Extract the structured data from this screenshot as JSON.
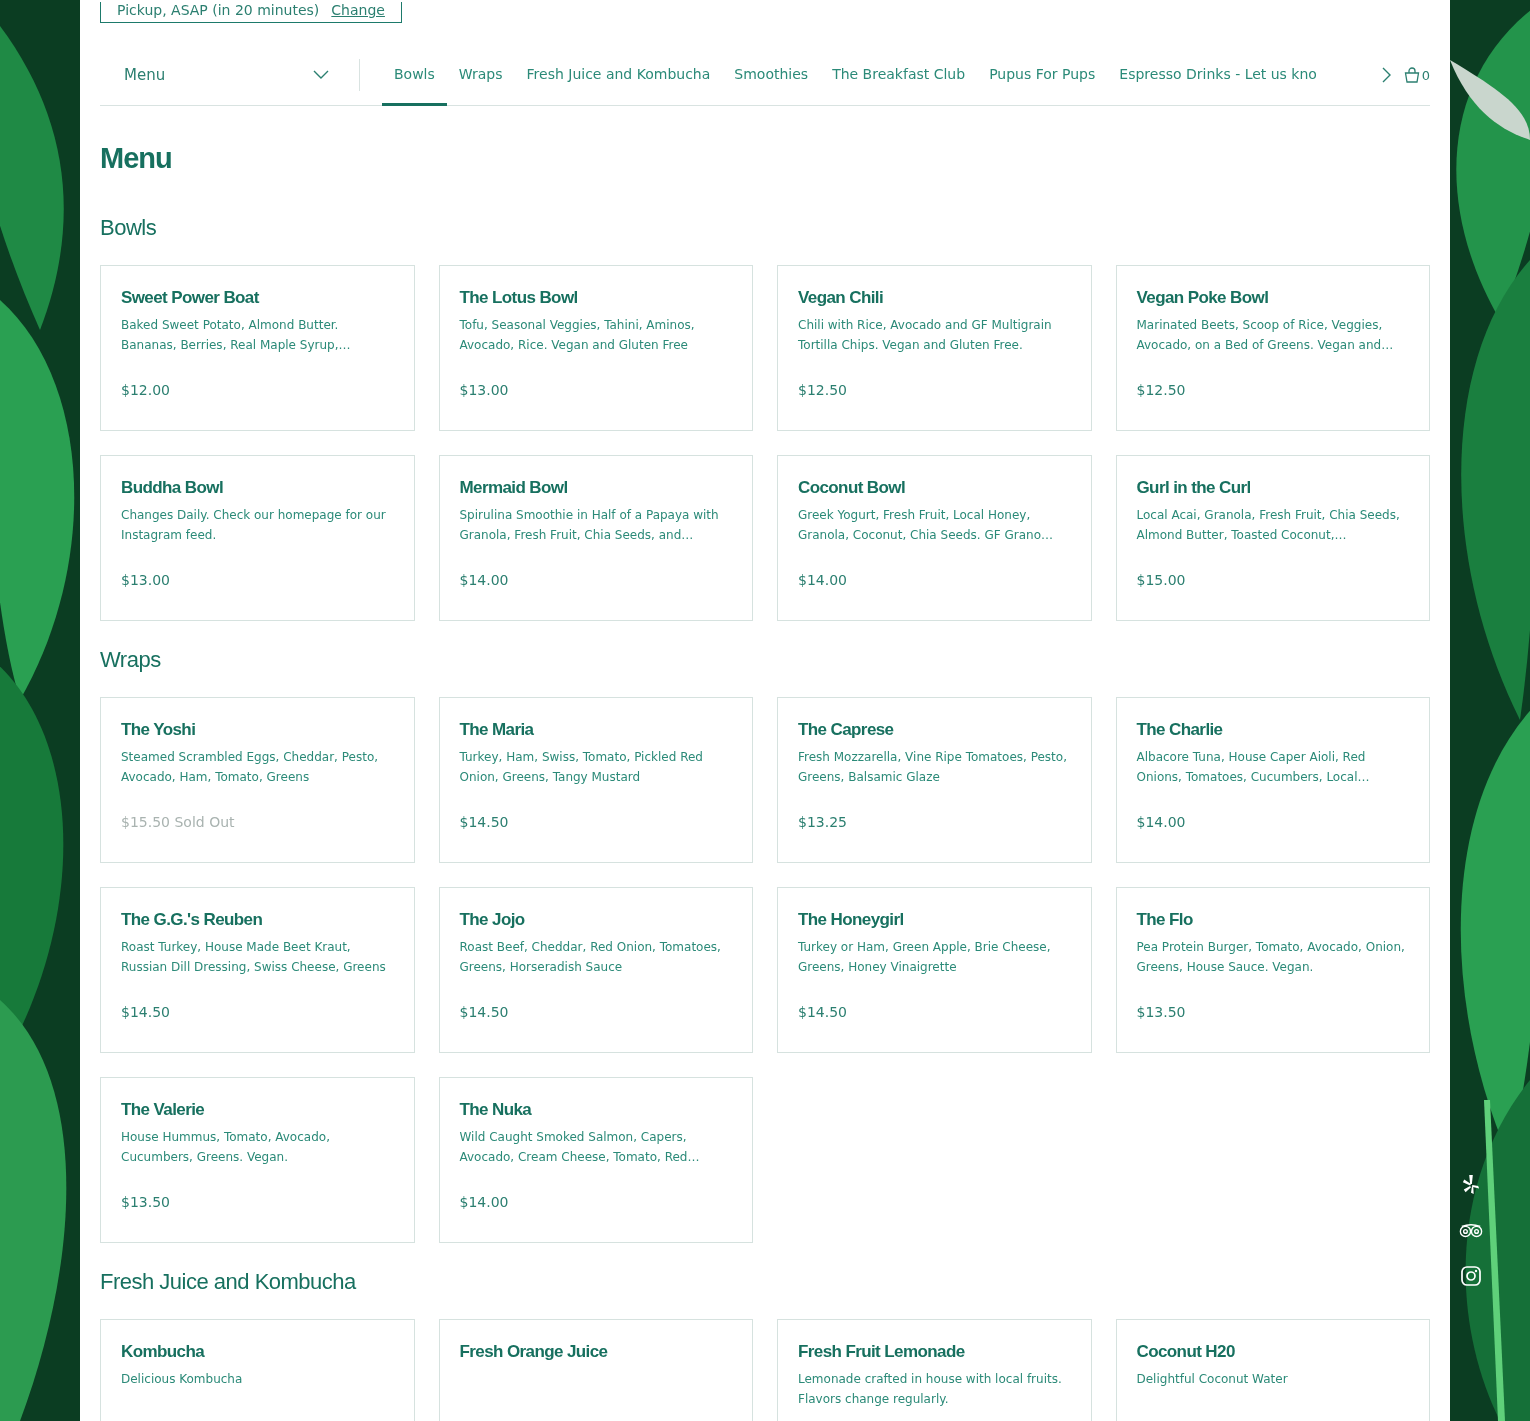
{
  "pickup": {
    "text": "Pickup, ASAP (in 20 minutes)",
    "link": "Change"
  },
  "nav": {
    "dropdown_label": "Menu",
    "tabs": [
      {
        "label": "Bowls",
        "selected": true
      },
      {
        "label": "Wraps",
        "selected": false
      },
      {
        "label": "Fresh Juice and Kombucha",
        "selected": false
      },
      {
        "label": "Smoothies",
        "selected": false
      },
      {
        "label": "The Breakfast Club",
        "selected": false
      },
      {
        "label": "Pupus For Pups",
        "selected": false
      },
      {
        "label": "Espresso Drinks - Let us kno",
        "selected": false
      }
    ],
    "cart_count": "0"
  },
  "title": "Menu",
  "sections": [
    {
      "title": "Bowls",
      "items": [
        {
          "name": "Sweet Power Boat",
          "description": "Baked Sweet Potato, Almond Butter. Bananas, Berries, Real Maple Syrup,…",
          "price": "$12.00",
          "sold_out": false
        },
        {
          "name": "The Lotus Bowl",
          "description": "Tofu, Seasonal Veggies, Tahini, Aminos, Avocado, Rice. Vegan and Gluten Free",
          "price": "$13.00",
          "sold_out": false
        },
        {
          "name": "Vegan Chili",
          "description": "Chili with Rice, Avocado and GF Multigrain Tortilla Chips. Vegan and Gluten Free.",
          "price": "$12.50",
          "sold_out": false
        },
        {
          "name": "Vegan Poke Bowl",
          "description": "Marinated Beets, Scoop of Rice, Veggies, Avocado, on a Bed of Greens. Vegan and…",
          "price": "$12.50",
          "sold_out": false
        },
        {
          "name": "Buddha Bowl",
          "description": "Changes Daily. Check our homepage for our Instagram feed.",
          "price": "$13.00",
          "sold_out": false
        },
        {
          "name": "Mermaid Bowl",
          "description": "Spirulina Smoothie in Half of a Papaya with Granola, Fresh Fruit, Chia Seeds, and…",
          "price": "$14.00",
          "sold_out": false
        },
        {
          "name": "Coconut Bowl",
          "description": "Greek Yogurt, Fresh Fruit, Local Honey, Granola, Coconut, Chia Seeds. GF Grano…",
          "price": "$14.00",
          "sold_out": false
        },
        {
          "name": "Gurl in the Curl",
          "description": "Local Acai, Granola, Fresh Fruit, Chia Seeds, Almond Butter, Toasted Coconut,…",
          "price": "$15.00",
          "sold_out": false
        }
      ]
    },
    {
      "title": "Wraps",
      "items": [
        {
          "name": "The Yoshi",
          "description": "Steamed Scrambled Eggs, Cheddar, Pesto, Avocado, Ham, Tomato, Greens",
          "price": "$15.50",
          "sold_out": true,
          "status": "Sold Out"
        },
        {
          "name": "The Maria",
          "description": "Turkey, Ham, Swiss, Tomato, Pickled Red Onion, Greens, Tangy Mustard",
          "price": "$14.50",
          "sold_out": false
        },
        {
          "name": "The Caprese",
          "description": "Fresh Mozzarella, Vine Ripe Tomatoes, Pesto, Greens, Balsamic Glaze",
          "price": "$13.25",
          "sold_out": false
        },
        {
          "name": "The Charlie",
          "description": "Albacore Tuna, House Caper Aioli, Red Onions, Tomatoes, Cucumbers, Local…",
          "price": "$14.00",
          "sold_out": false
        },
        {
          "name": "The G.G.'s Reuben",
          "description": "Roast Turkey, House Made Beet Kraut, Russian Dill Dressing, Swiss Cheese, Greens",
          "price": "$14.50",
          "sold_out": false
        },
        {
          "name": "The Jojo",
          "description": "Roast Beef, Cheddar, Red Onion, Tomatoes, Greens, Horseradish Sauce",
          "price": "$14.50",
          "sold_out": false
        },
        {
          "name": "The Honeygirl",
          "description": "Turkey or Ham, Green Apple, Brie Cheese, Greens, Honey Vinaigrette",
          "price": "$14.50",
          "sold_out": false
        },
        {
          "name": "The Flo",
          "description": "Pea Protein Burger, Tomato, Avocado, Onion, Greens, House Sauce. Vegan.",
          "price": "$13.50",
          "sold_out": false
        },
        {
          "name": "The Valerie",
          "description": "House Hummus, Tomato, Avocado, Cucumbers, Greens. Vegan.",
          "price": "$13.50",
          "sold_out": false
        },
        {
          "name": "The Nuka",
          "description": "Wild Caught Smoked Salmon, Capers, Avocado, Cream Cheese, Tomato, Red…",
          "price": "$14.00",
          "sold_out": false
        }
      ]
    },
    {
      "title": "Fresh Juice and Kombucha",
      "items": [
        {
          "name": "Kombucha",
          "description": "Delicious Kombucha"
        },
        {
          "name": "Fresh Orange Juice"
        },
        {
          "name": "Fresh Fruit Lemonade",
          "description": "Lemonade crafted in house with local fruits. Flavors change regularly."
        },
        {
          "name": "Coconut H20",
          "description": "Delightful Coconut Water"
        }
      ]
    }
  ]
}
